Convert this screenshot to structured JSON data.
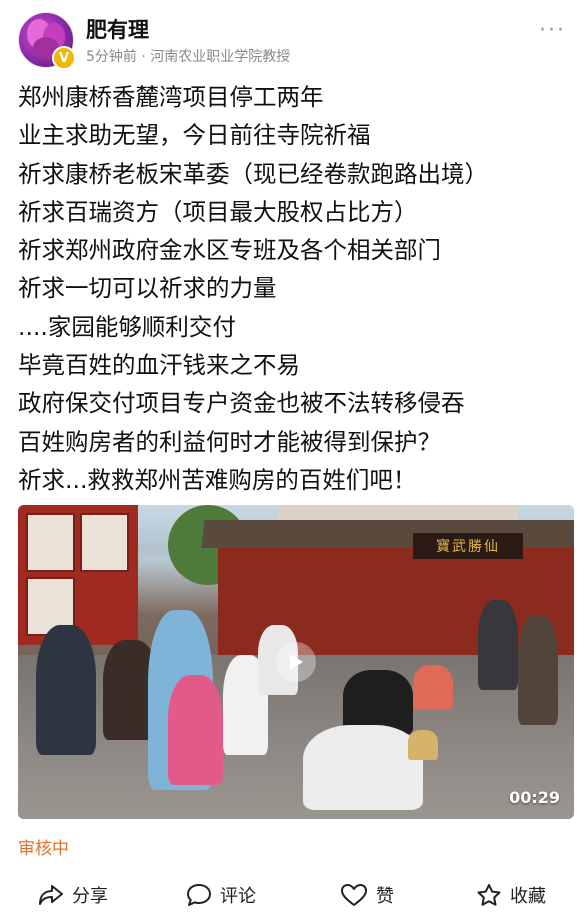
{
  "header": {
    "username": "肥有理",
    "time": "5分钟前",
    "separator": "·",
    "affiliation": "河南农业职业学院教授",
    "badge": "V",
    "more_icon": "ellipsis-icon"
  },
  "post": {
    "lines": [
      "郑州康桥香麓湾项目停工两年",
      "业主求助无望，今日前往寺院祈福",
      "祈求康桥老板宋革委（现已经卷款跑路出境）",
      "祈求百瑞资方（项目最大股权占比方）",
      "祈求郑州政府金水区专班及各个相关部门",
      "祈求一切可以祈求的力量",
      "....家园能够顺利交付",
      "毕竟百姓的血汗钱来之不易",
      "政府保交付项目专户资金也被不法转移侵吞",
      "百姓购房者的利益何时才能被得到保护？",
      "祈求...救救郑州苦难购房的百姓们吧！"
    ]
  },
  "video": {
    "duration": "00:29",
    "sign_text": "寶武勝仙",
    "play_icon": "play-icon"
  },
  "status": {
    "review": "审核中"
  },
  "actions": {
    "share": "分享",
    "comment": "评论",
    "like": "赞",
    "favorite": "收藏"
  },
  "colors": {
    "accent_orange": "#e0712b",
    "meta_gray": "#8a8a8a",
    "badge_gold": "#f2b705"
  }
}
